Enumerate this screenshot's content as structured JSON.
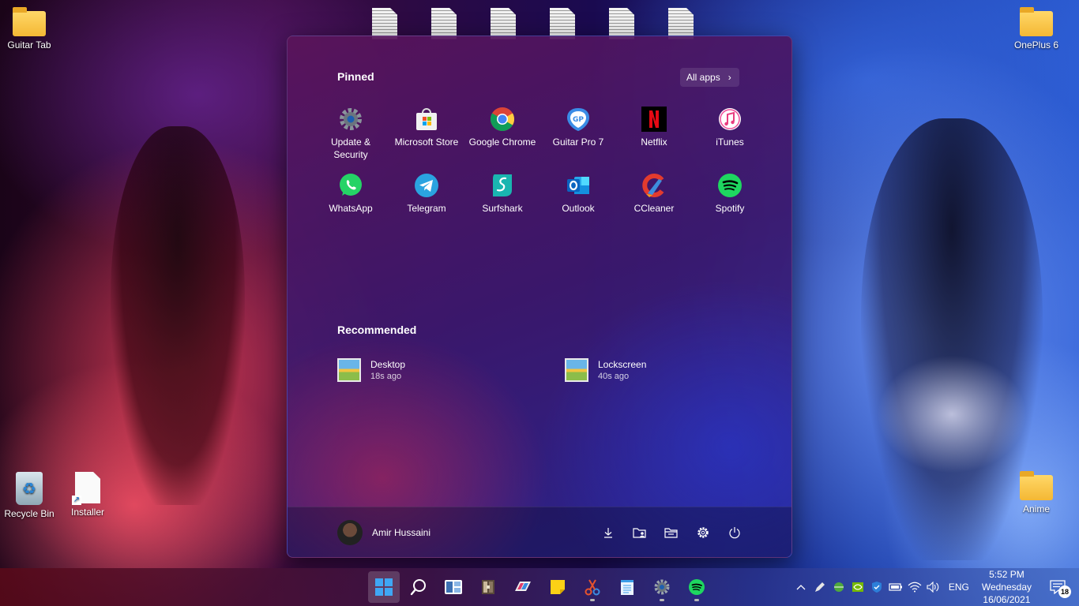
{
  "desktop": {
    "icons": [
      {
        "label": "Guitar Tab"
      },
      {
        "label": "OnePlus 6"
      },
      {
        "label": "Recycle Bin"
      },
      {
        "label": "Installer"
      },
      {
        "label": "Anime"
      }
    ]
  },
  "start_menu": {
    "pinned_title": "Pinned",
    "all_apps_label": "All apps",
    "pinned": [
      {
        "label": "Update & Security",
        "icon": "gear-icon"
      },
      {
        "label": "Microsoft Store",
        "icon": "store-icon"
      },
      {
        "label": "Google Chrome",
        "icon": "chrome-icon"
      },
      {
        "label": "Guitar Pro 7",
        "icon": "guitar-pro-icon"
      },
      {
        "label": "Netflix",
        "icon": "netflix-icon"
      },
      {
        "label": "iTunes",
        "icon": "itunes-icon"
      },
      {
        "label": "WhatsApp",
        "icon": "whatsapp-icon"
      },
      {
        "label": "Telegram",
        "icon": "telegram-icon"
      },
      {
        "label": "Surfshark",
        "icon": "surfshark-icon"
      },
      {
        "label": "Outlook",
        "icon": "outlook-icon"
      },
      {
        "label": "CCleaner",
        "icon": "ccleaner-icon"
      },
      {
        "label": "Spotify",
        "icon": "spotify-icon"
      }
    ],
    "recommended_title": "Recommended",
    "recommended": [
      {
        "name": "Desktop",
        "time": "18s ago"
      },
      {
        "name": "Lockscreen",
        "time": "40s ago"
      }
    ],
    "user_name": "Amir Hussaini"
  },
  "taskbar": {
    "language": "ENG",
    "time": "5:52 PM",
    "day": "Wednesday",
    "date": "16/06/2021",
    "notification_count": "18"
  }
}
